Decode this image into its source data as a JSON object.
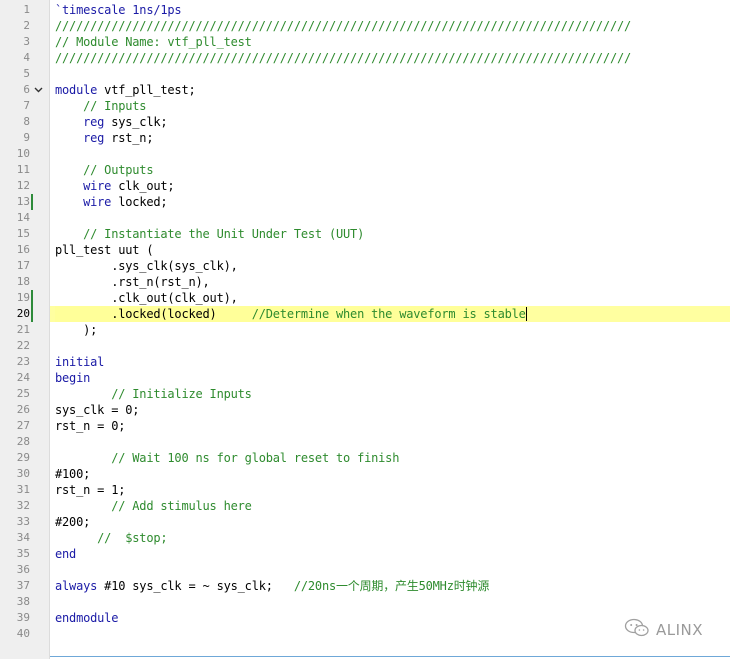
{
  "editor": {
    "current_line": 20,
    "lines": [
      {
        "n": "1",
        "segs": [
          {
            "t": "`timescale 1ns/1ps",
            "c": "kw"
          }
        ]
      },
      {
        "n": "2",
        "segs": [
          {
            "t": "//////////////////////////////////////////////////////////////////////////////////",
            "c": "cm"
          }
        ]
      },
      {
        "n": "3",
        "segs": [
          {
            "t": "// Module Name: vtf_pll_test",
            "c": "cm"
          }
        ]
      },
      {
        "n": "4",
        "segs": [
          {
            "t": "//////////////////////////////////////////////////////////////////////////////////",
            "c": "cm"
          }
        ]
      },
      {
        "n": "5",
        "segs": []
      },
      {
        "n": "6",
        "fold": true,
        "segs": [
          {
            "t": "module",
            "c": "kw"
          },
          {
            "t": " vtf_pll_test;",
            "c": ""
          }
        ]
      },
      {
        "n": "7",
        "segs": [
          {
            "t": "    ",
            "c": ""
          },
          {
            "t": "// Inputs",
            "c": "cm"
          }
        ]
      },
      {
        "n": "8",
        "segs": [
          {
            "t": "    ",
            "c": ""
          },
          {
            "t": "reg",
            "c": "kw"
          },
          {
            "t": " sys_clk;",
            "c": ""
          }
        ]
      },
      {
        "n": "9",
        "segs": [
          {
            "t": "    ",
            "c": ""
          },
          {
            "t": "reg",
            "c": "kw"
          },
          {
            "t": " rst_n;",
            "c": ""
          }
        ]
      },
      {
        "n": "10",
        "segs": []
      },
      {
        "n": "11",
        "segs": [
          {
            "t": "    ",
            "c": ""
          },
          {
            "t": "// Outputs",
            "c": "cm"
          }
        ]
      },
      {
        "n": "12",
        "segs": [
          {
            "t": "    ",
            "c": ""
          },
          {
            "t": "wire",
            "c": "kw"
          },
          {
            "t": " clk_out;",
            "c": ""
          }
        ]
      },
      {
        "n": "13",
        "mark": true,
        "segs": [
          {
            "t": "    ",
            "c": ""
          },
          {
            "t": "wire",
            "c": "kw"
          },
          {
            "t": " locked;",
            "c": ""
          }
        ]
      },
      {
        "n": "14",
        "segs": []
      },
      {
        "n": "15",
        "segs": [
          {
            "t": "    ",
            "c": ""
          },
          {
            "t": "// Instantiate the Unit Under Test (UUT)",
            "c": "cm"
          }
        ]
      },
      {
        "n": "16",
        "segs": [
          {
            "t": "pll_test uut (",
            "c": ""
          }
        ]
      },
      {
        "n": "17",
        "segs": [
          {
            "t": "        .sys_clk(sys_clk),",
            "c": ""
          }
        ]
      },
      {
        "n": "18",
        "segs": [
          {
            "t": "        .rst_n(rst_n),",
            "c": ""
          }
        ]
      },
      {
        "n": "19",
        "mark": true,
        "segs": [
          {
            "t": "        .clk_out(clk_out),",
            "c": ""
          }
        ]
      },
      {
        "n": "20",
        "mark": true,
        "caret": true,
        "segs": [
          {
            "t": "        .locked(locked)     ",
            "c": ""
          },
          {
            "t": "//Determine when the waveform is stable",
            "c": "cm"
          }
        ]
      },
      {
        "n": "21",
        "segs": [
          {
            "t": "    );",
            "c": ""
          }
        ]
      },
      {
        "n": "22",
        "segs": []
      },
      {
        "n": "23",
        "segs": [
          {
            "t": "initial",
            "c": "kw"
          }
        ]
      },
      {
        "n": "24",
        "segs": [
          {
            "t": "begin",
            "c": "kw"
          }
        ]
      },
      {
        "n": "25",
        "segs": [
          {
            "t": "        ",
            "c": ""
          },
          {
            "t": "// Initialize Inputs",
            "c": "cm"
          }
        ]
      },
      {
        "n": "26",
        "segs": [
          {
            "t": "sys_clk = 0;",
            "c": ""
          }
        ]
      },
      {
        "n": "27",
        "segs": [
          {
            "t": "rst_n = 0;",
            "c": ""
          }
        ]
      },
      {
        "n": "28",
        "segs": []
      },
      {
        "n": "29",
        "segs": [
          {
            "t": "        ",
            "c": ""
          },
          {
            "t": "// Wait 100 ns for global reset to finish",
            "c": "cm"
          }
        ]
      },
      {
        "n": "30",
        "segs": [
          {
            "t": "#100;",
            "c": ""
          }
        ]
      },
      {
        "n": "31",
        "segs": [
          {
            "t": "rst_n = 1;",
            "c": ""
          }
        ]
      },
      {
        "n": "32",
        "segs": [
          {
            "t": "        ",
            "c": ""
          },
          {
            "t": "// Add stimulus here",
            "c": "cm"
          }
        ]
      },
      {
        "n": "33",
        "segs": [
          {
            "t": "#200;",
            "c": ""
          }
        ]
      },
      {
        "n": "34",
        "segs": [
          {
            "t": "      ",
            "c": ""
          },
          {
            "t": "//  $stop;",
            "c": "cm"
          }
        ]
      },
      {
        "n": "35",
        "segs": [
          {
            "t": "end",
            "c": "kw"
          }
        ]
      },
      {
        "n": "36",
        "segs": []
      },
      {
        "n": "37",
        "segs": [
          {
            "t": "always",
            "c": "kw"
          },
          {
            "t": " #10 sys_clk = ~ sys_clk;   ",
            "c": ""
          },
          {
            "t": "//20ns一个周期，产生50MHz时钟源",
            "c": "cm"
          }
        ]
      },
      {
        "n": "38",
        "segs": []
      },
      {
        "n": "39",
        "segs": [
          {
            "t": "endmodule",
            "c": "kw"
          }
        ]
      },
      {
        "n": "40",
        "segs": []
      }
    ]
  },
  "watermark": {
    "text": "ALINX",
    "icon": "wechat-icon"
  }
}
